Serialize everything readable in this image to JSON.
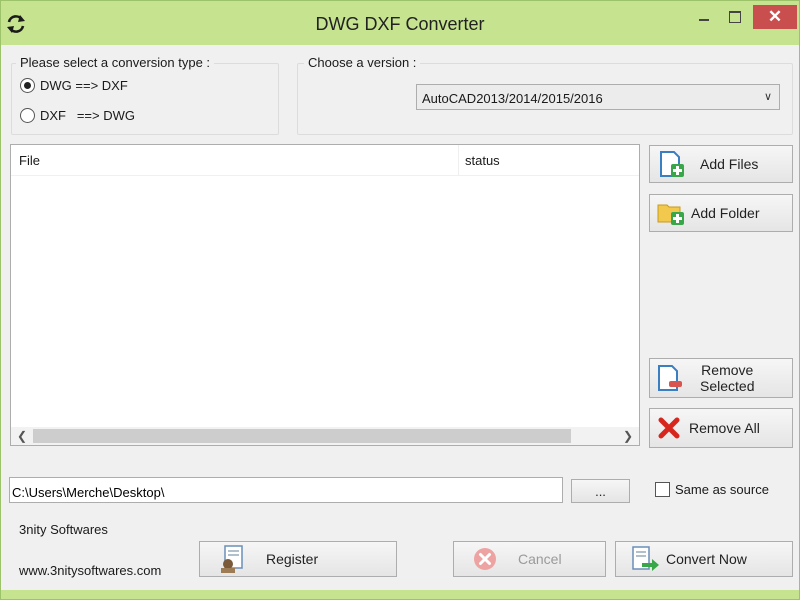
{
  "window": {
    "title": "DWG DXF Converter",
    "close_glyph": "✕",
    "accent_color": "#c6e38f",
    "close_color": "#c94f4f"
  },
  "conversion": {
    "label": "Please select a conversion type :",
    "options": [
      {
        "label": "DWG ==> DXF",
        "checked": true
      },
      {
        "label": "DXF   ==> DWG",
        "checked": false
      }
    ]
  },
  "version": {
    "label": "Choose a version :",
    "selected": "AutoCAD2013/2014/2015/2016"
  },
  "file_list": {
    "columns": [
      "File",
      "status"
    ],
    "rows": []
  },
  "side_buttons": {
    "add_files": "Add Files",
    "add_folder": "Add Folder",
    "remove_selected_line1": "Remove",
    "remove_selected_line2": "Selected",
    "remove_all": "Remove All"
  },
  "output": {
    "path": "C:\\Users\\Merche\\Desktop\\",
    "browse_label": "...",
    "same_as_source_label": "Same as source",
    "same_as_source_checked": false
  },
  "footer": {
    "brand": "3nity Softwares",
    "website": "www.3nitysoftwares.com",
    "register_label": "Register",
    "cancel_label": "Cancel",
    "convert_label": "Convert Now"
  },
  "icons": {
    "app": "converter-arrows-icon",
    "add_files": "file-add-icon",
    "add_folder": "folder-add-icon",
    "remove_selected": "file-remove-icon",
    "remove_all": "red-x-icon",
    "register": "certificate-icon",
    "cancel": "cancel-circle-icon",
    "convert": "convert-arrow-icon"
  }
}
